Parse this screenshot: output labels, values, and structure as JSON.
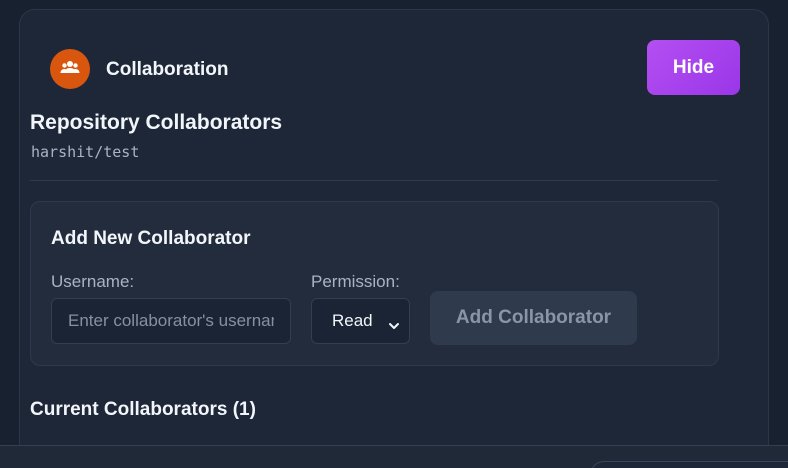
{
  "header": {
    "title": "Collaboration",
    "icon": "users-icon",
    "icon_color": "#d9560e",
    "hide_label": "Hide",
    "hide_color": "#a843ee"
  },
  "repo": {
    "title": "Repository Collaborators",
    "name": "harshit/test"
  },
  "add_form": {
    "title": "Add New Collaborator",
    "username_label": "Username:",
    "username_placeholder": "Enter collaborator's username",
    "username_value": "",
    "permission_label": "Permission:",
    "permission_selected": "Read",
    "submit_label": "Add Collaborator"
  },
  "current": {
    "title": "Current Collaborators (1)"
  }
}
